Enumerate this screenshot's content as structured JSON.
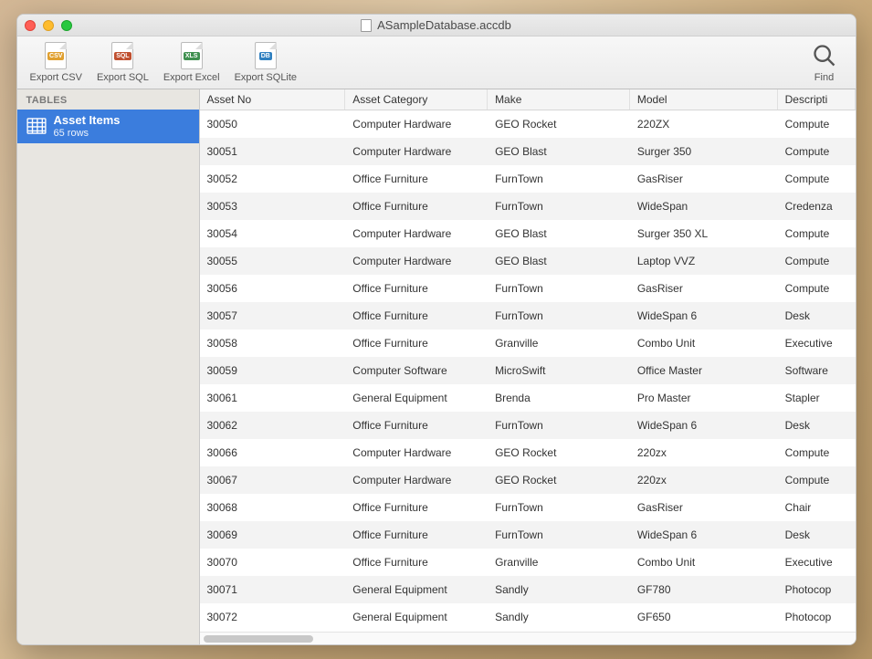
{
  "window": {
    "title": "ASampleDatabase.accdb"
  },
  "toolbar": {
    "export_csv": "Export CSV",
    "export_sql": "Export SQL",
    "export_excel": "Export Excel",
    "export_sqlite": "Export SQLite",
    "find": "Find"
  },
  "sidebar": {
    "header": "TABLES",
    "items": [
      {
        "name": "Asset Items",
        "count": "65 rows"
      }
    ]
  },
  "grid": {
    "columns": [
      "Asset No",
      "Asset Category",
      "Make",
      "Model",
      "Descripti"
    ],
    "rows": [
      [
        "30050",
        "Computer Hardware",
        "GEO Rocket",
        "220ZX",
        "Compute"
      ],
      [
        "30051",
        "Computer Hardware",
        "GEO Blast",
        "Surger 350",
        "Compute"
      ],
      [
        "30052",
        "Office Furniture",
        "FurnTown",
        "GasRiser",
        "Compute"
      ],
      [
        "30053",
        "Office Furniture",
        "FurnTown",
        "WideSpan",
        "Credenza"
      ],
      [
        "30054",
        "Computer Hardware",
        "GEO Blast",
        "Surger 350 XL",
        "Compute"
      ],
      [
        "30055",
        "Computer Hardware",
        "GEO Blast",
        "Laptop VVZ",
        "Compute"
      ],
      [
        "30056",
        "Office Furniture",
        "FurnTown",
        "GasRiser",
        "Compute"
      ],
      [
        "30057",
        "Office Furniture",
        "FurnTown",
        "WideSpan 6",
        "Desk"
      ],
      [
        "30058",
        "Office Furniture",
        "Granville",
        "Combo Unit",
        "Executive"
      ],
      [
        "30059",
        "Computer Software",
        "MicroSwift",
        "Office Master",
        "Software"
      ],
      [
        "30061",
        "General Equipment",
        "Brenda",
        "Pro Master",
        "Stapler"
      ],
      [
        "30062",
        "Office Furniture",
        "FurnTown",
        "WideSpan 6",
        "Desk"
      ],
      [
        "30066",
        "Computer Hardware",
        "GEO Rocket",
        "220zx",
        "Compute"
      ],
      [
        "30067",
        "Computer Hardware",
        "GEO Rocket",
        "220zx",
        "Compute"
      ],
      [
        "30068",
        "Office Furniture",
        "FurnTown",
        "GasRiser",
        "Chair"
      ],
      [
        "30069",
        "Office Furniture",
        "FurnTown",
        "WideSpan 6",
        "Desk"
      ],
      [
        "30070",
        "Office Furniture",
        "Granville",
        "Combo Unit",
        "Executive"
      ],
      [
        "30071",
        "General Equipment",
        "Sandly",
        "GF780",
        "Photocop"
      ],
      [
        "30072",
        "General Equipment",
        "Sandly",
        "GF650",
        "Photocop"
      ]
    ]
  }
}
